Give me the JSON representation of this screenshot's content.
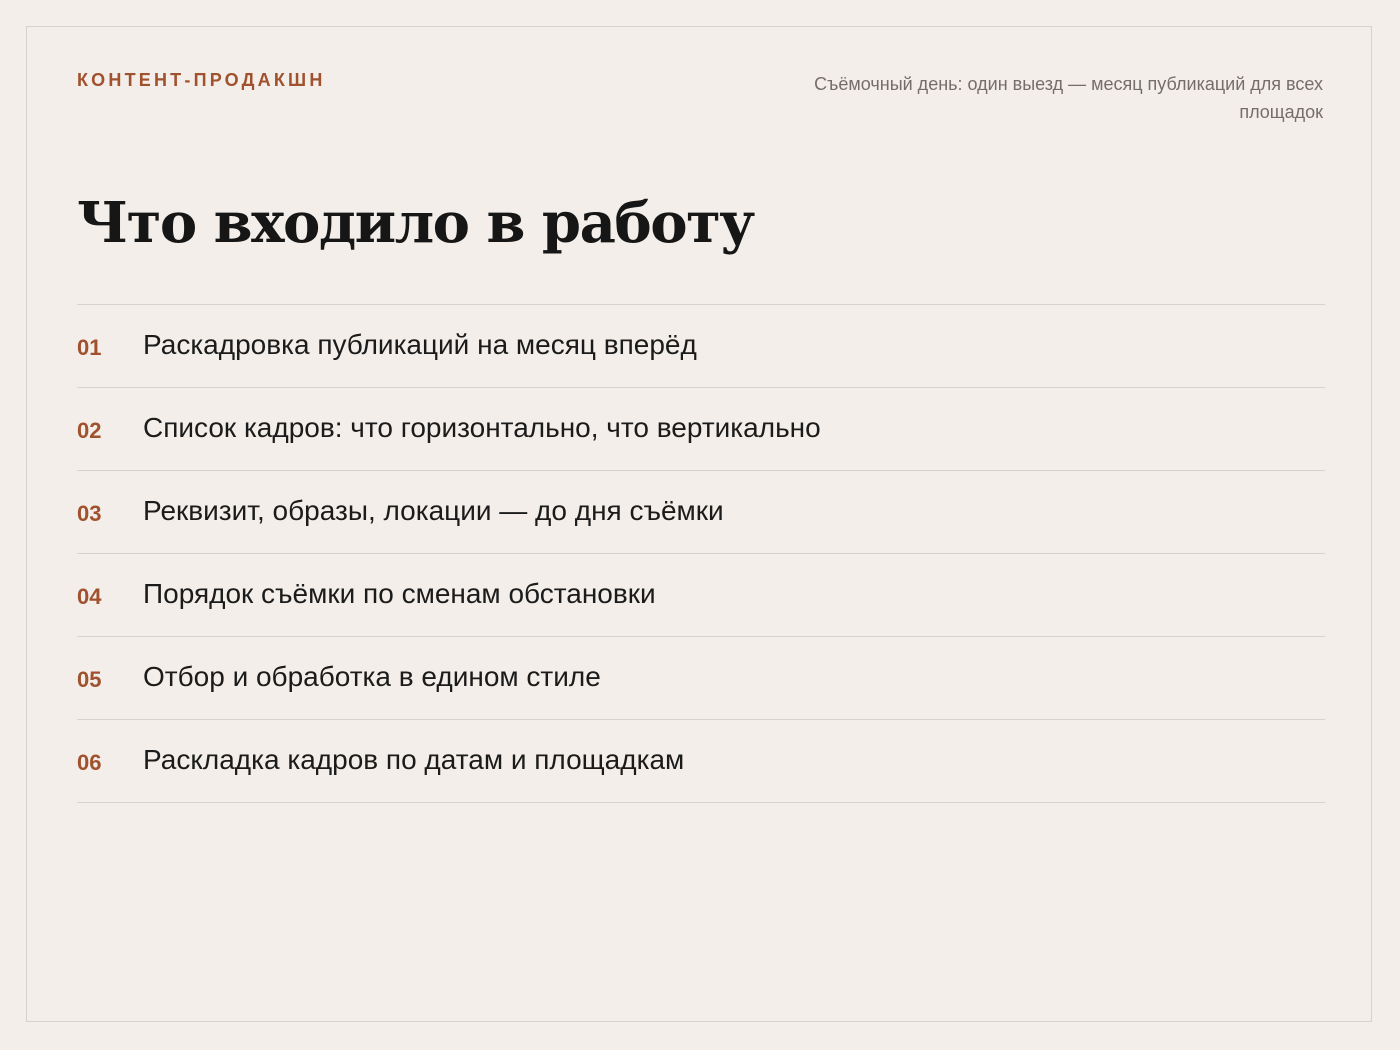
{
  "header": {
    "eyebrow": "КОНТЕНТ-ПРОДАКШН",
    "caption": "Съёмочный день: один выезд — месяц публикаций для всех площадок"
  },
  "title": "Что входило в работу",
  "items": [
    {
      "num": "01",
      "text": "Раскадровка публикаций на месяц вперёд"
    },
    {
      "num": "02",
      "text": "Список кадров: что горизонтально, что вертикально"
    },
    {
      "num": "03",
      "text": "Реквизит, образы, локации — до дня съёмки"
    },
    {
      "num": "04",
      "text": "Порядок съёмки по сменам обстановки"
    },
    {
      "num": "05",
      "text": "Отбор и обработка в едином стиле"
    },
    {
      "num": "06",
      "text": "Раскладка кадров по датам и площадкам"
    }
  ],
  "colors": {
    "accent": "#a0512d",
    "background": "#f3eee9",
    "text": "#1b1b1b",
    "muted": "#756e68",
    "divider": "#d8d2cc"
  }
}
